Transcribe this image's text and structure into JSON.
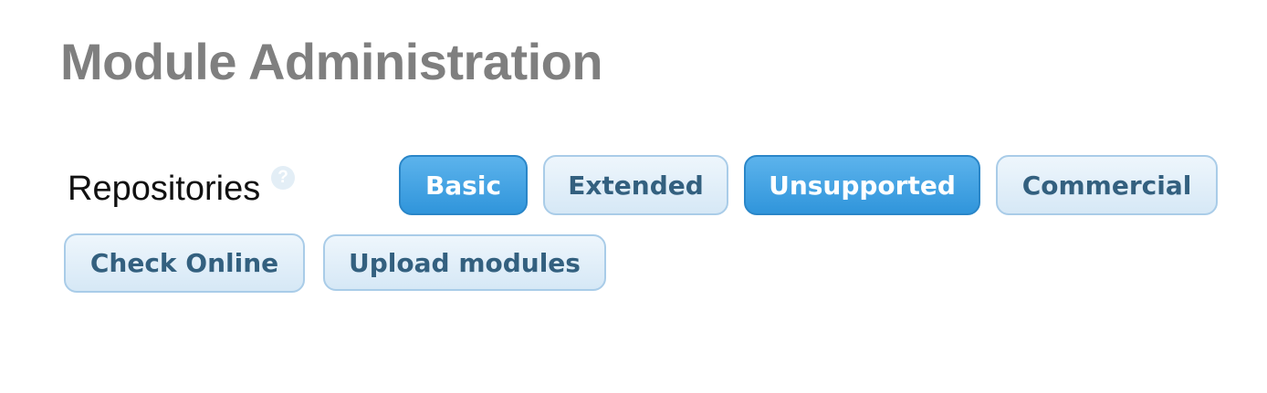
{
  "page": {
    "title": "Module Administration"
  },
  "repositories": {
    "label": "Repositories",
    "help_glyph": "?",
    "buttons": [
      {
        "label": "Basic",
        "active": true
      },
      {
        "label": "Extended",
        "active": false
      },
      {
        "label": "Unsupported",
        "active": true
      },
      {
        "label": "Commercial",
        "active": false
      }
    ]
  },
  "actions": {
    "check_online": "Check Online",
    "upload_modules": "Upload modules"
  },
  "colors": {
    "title_gray": "#7f7f7f",
    "button_active": "#3a9be0",
    "button_inactive_bg": "#e2effa",
    "button_inactive_text": "#33607f"
  }
}
